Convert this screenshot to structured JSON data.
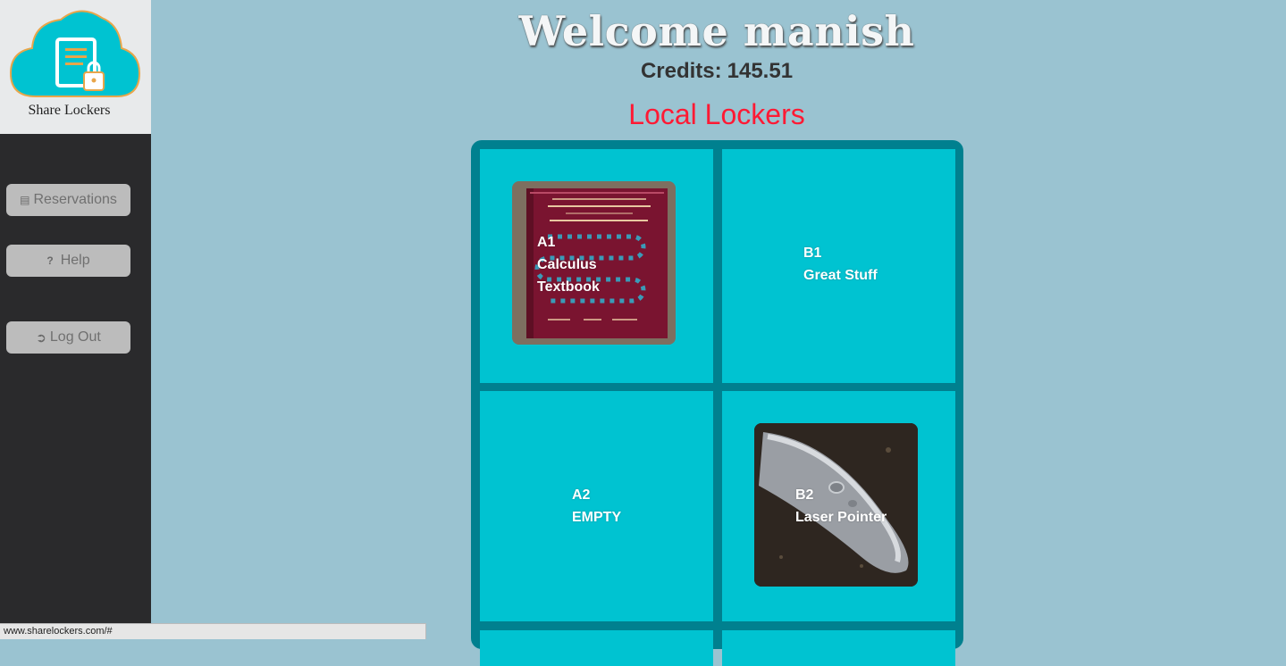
{
  "brand": {
    "name": "Share Lockers"
  },
  "sidebar": {
    "items": [
      {
        "label": "Reservations",
        "icon": "calendar-icon"
      },
      {
        "label": "Help",
        "icon": "question-icon"
      },
      {
        "label": "Log Out",
        "icon": "logout-icon"
      }
    ]
  },
  "header": {
    "welcome": "Welcome manish",
    "credits_label": "Credits:",
    "credits_value": "145.51"
  },
  "section": {
    "title": "Local Lockers"
  },
  "lockers": [
    {
      "id": "A1",
      "lines": [
        "Calculus",
        "Textbook"
      ],
      "image": "textbook-photo"
    },
    {
      "id": "B1",
      "lines": [
        "Great Stuff"
      ],
      "image": ""
    },
    {
      "id": "A2",
      "lines": [
        "EMPTY"
      ],
      "image": ""
    },
    {
      "id": "B2",
      "lines": [
        "Laser Pointer"
      ],
      "image": "laser-pointer-photo"
    }
  ],
  "status_bar": {
    "url": "www.sharelockers.com/#"
  },
  "colors": {
    "background": "#9ac3d1",
    "sidebar": "#2a2a2c",
    "locker_frame": "#00808f",
    "locker_cell": "#00c3d1",
    "section_title": "#ff1a34"
  }
}
